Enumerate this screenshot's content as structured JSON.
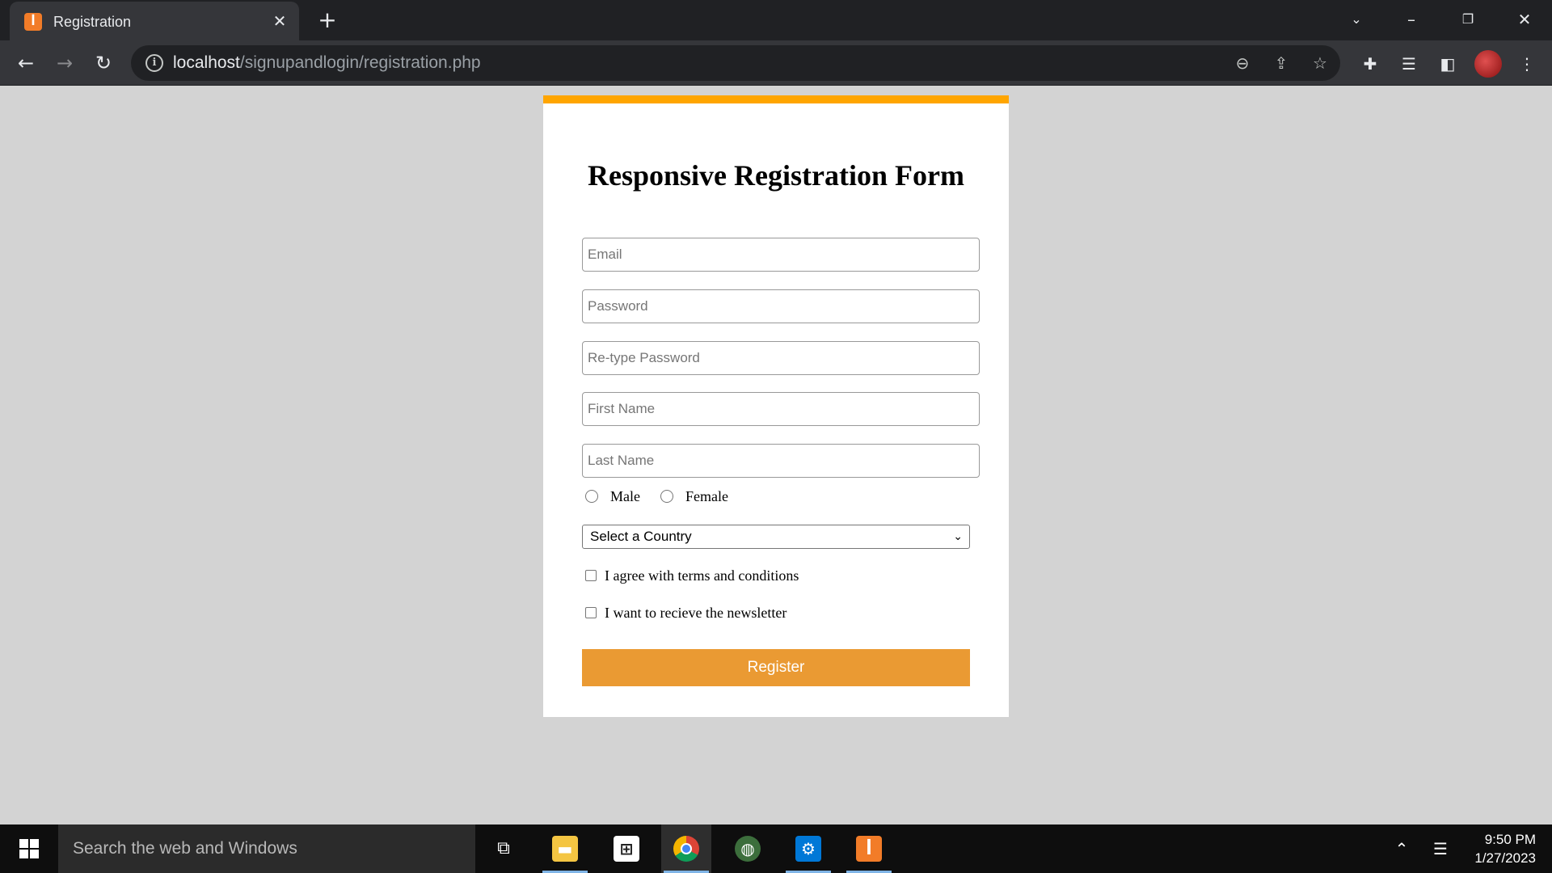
{
  "browser": {
    "tab_title": "Registration",
    "tab_favicon": "xampp-icon",
    "url_host": "localhost",
    "url_path": "/signupandlogin/registration.php"
  },
  "form": {
    "title": "Responsive Registration Form",
    "email_placeholder": "Email",
    "password_placeholder": "Password",
    "retype_placeholder": "Re-type Password",
    "first_name_placeholder": "First Name",
    "last_name_placeholder": "Last Name",
    "gender_male": "Male",
    "gender_female": "Female",
    "country_selected": "Select a Country",
    "terms_label": "I agree with terms and conditions",
    "newsletter_label": "I want to recieve the newsletter",
    "register_label": "Register",
    "accent_color": "#ffa500",
    "button_color": "#ea9a33"
  },
  "taskbar": {
    "search_placeholder": "Search the web and Windows",
    "time": "9:50 PM",
    "date": "1/27/2023"
  }
}
